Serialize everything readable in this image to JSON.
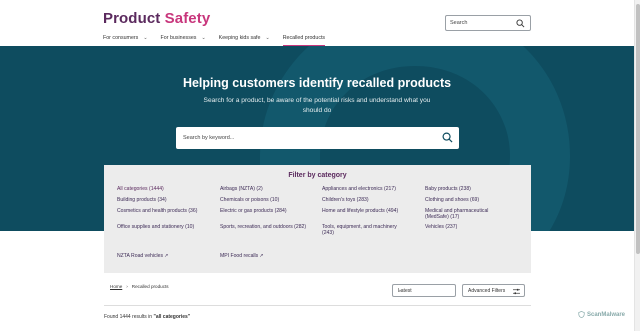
{
  "header": {
    "logo_part1": "Product",
    "logo_part2": "Safety",
    "search_placeholder": "Search"
  },
  "nav": [
    {
      "label": "For consumers",
      "has_chevron": true
    },
    {
      "label": "For businesses",
      "has_chevron": true
    },
    {
      "label": "Keeping kids safe",
      "has_chevron": true
    },
    {
      "label": "Recalled products",
      "has_chevron": false,
      "active": true
    }
  ],
  "hero": {
    "title": "Helping customers identify recalled products",
    "subtitle": "Search for a product, be aware of the potential risks and understand what you should do",
    "search_placeholder": "Search by keyword..."
  },
  "filter": {
    "title": "Filter by category",
    "categories": [
      "All categories (1444)",
      "Airbags (NZTA) (2)",
      "Appliances and electronics (217)",
      "Baby products (238)",
      "Building products (34)",
      "Chemicals or poisons (10)",
      "Children's toys (283)",
      "Clothing and shoes (69)",
      "Cosmetics and health products (36)",
      "Electric or gas products (284)",
      "Home and lifestyle products (494)",
      "Medical and pharmaceutical (MedSafe) (17)",
      "Office supplies and stationery (10)",
      "Sports, recreation, and outdoors (282)",
      "Tools, equipment, and machinery (243)",
      "Vehicles (237)"
    ],
    "external_links": [
      "NZTA Road vehicles",
      "MPI Food recalls"
    ]
  },
  "breadcrumb": {
    "home": "Home",
    "current": "Recalled products"
  },
  "controls": {
    "sort_value": "Latest",
    "advanced_label": "Advanced Filters"
  },
  "results": {
    "prefix": "Found 1444 results in ",
    "term": "\"all categories\""
  },
  "watermark": "ScanMalware",
  "colors": {
    "brand_purple": "#5b2a5e",
    "brand_pink": "#c8367c",
    "hero_bg": "#0e4c5f",
    "panel_bg": "#ececec"
  }
}
